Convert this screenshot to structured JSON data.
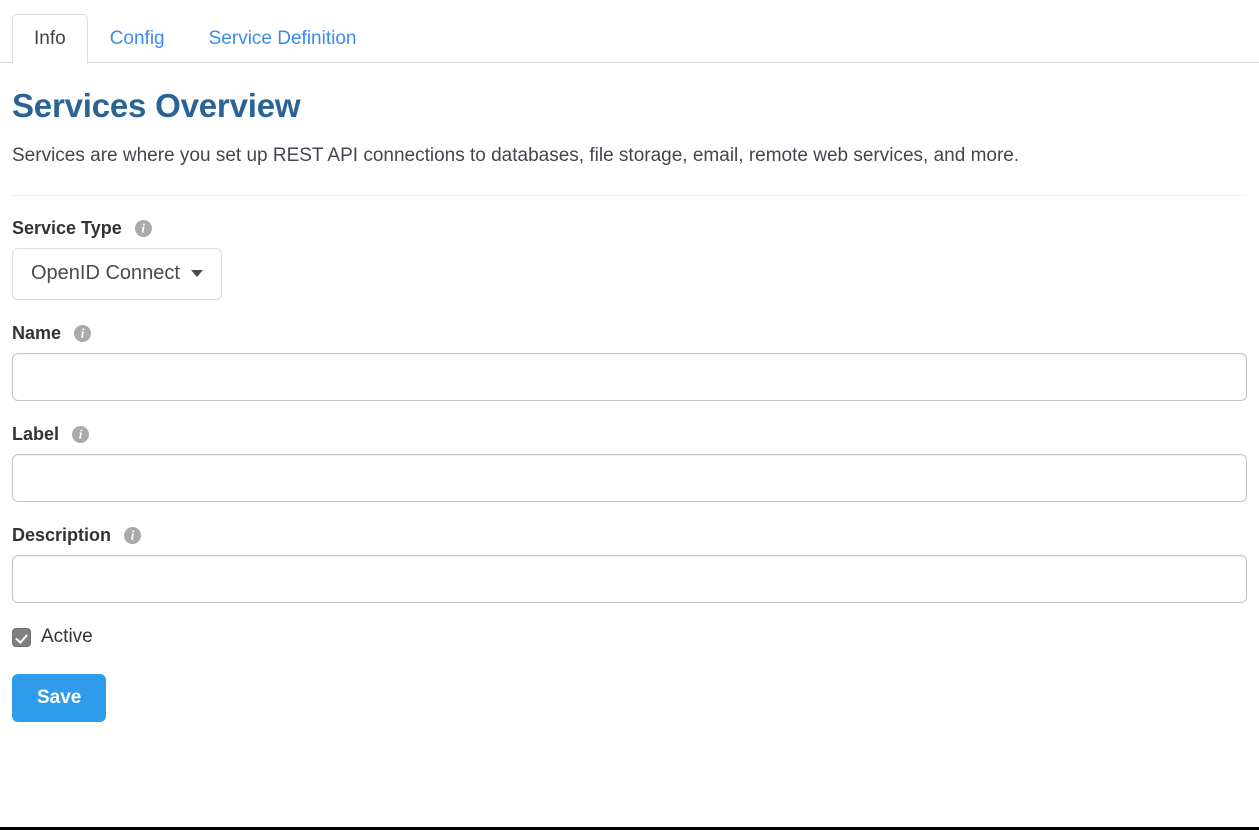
{
  "tabs": [
    {
      "label": "Info",
      "active": true
    },
    {
      "label": "Config",
      "active": false
    },
    {
      "label": "Service Definition",
      "active": false
    }
  ],
  "header": {
    "title": "Services Overview",
    "description": "Services are where you set up REST API connections to databases, file storage, email, remote web services, and more."
  },
  "form": {
    "service_type": {
      "label": "Service Type",
      "info_icon": "info-icon",
      "selected": "OpenID Connect",
      "caret_icon": "caret-down-icon"
    },
    "name": {
      "label": "Name",
      "info_icon": "info-icon",
      "value": "",
      "placeholder": ""
    },
    "label_field": {
      "label": "Label",
      "info_icon": "info-icon",
      "value": "",
      "placeholder": ""
    },
    "description_field": {
      "label": "Description",
      "info_icon": "info-icon",
      "value": "",
      "placeholder": ""
    },
    "active_checkbox": {
      "label": "Active",
      "checked": true
    },
    "save_button": "Save"
  },
  "colors": {
    "link_blue": "#3b8beb",
    "title_blue": "#2a6496",
    "save_button_blue": "#2f9beb",
    "border_gray": "#c4c4c4",
    "info_icon_gray": "#aaaaaa",
    "checkbox_gray": "#808080"
  }
}
